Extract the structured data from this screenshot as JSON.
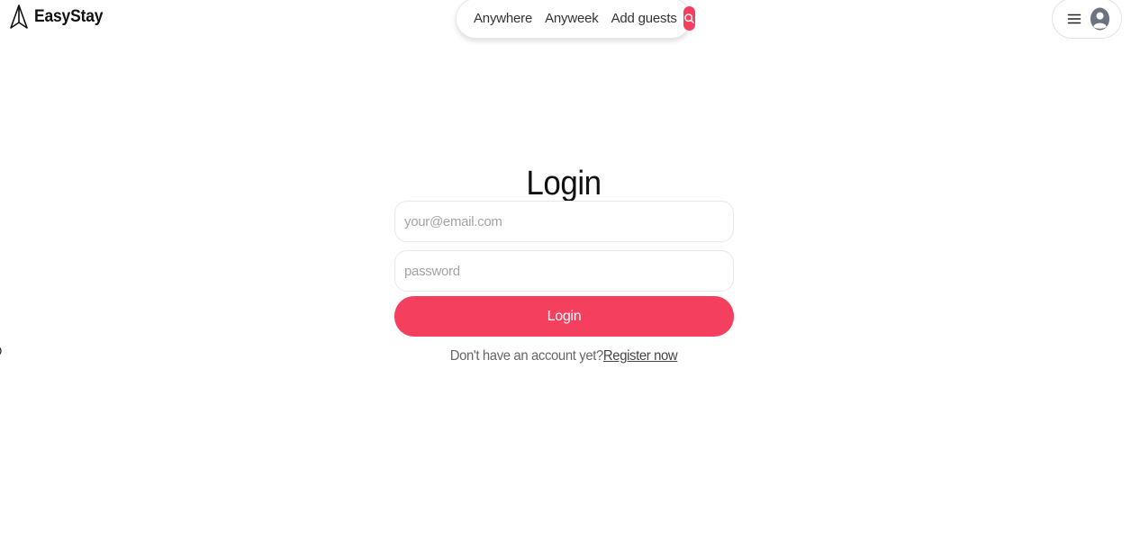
{
  "header": {
    "brand": "EasyStay",
    "search": {
      "location": "Anywhere",
      "week": "Anyweek",
      "guests": "Add guests"
    }
  },
  "login": {
    "title": "Login",
    "email_placeholder": "your@email.com",
    "password_placeholder": "password",
    "button_label": "Login",
    "register_prompt": "Don't have an account yet?",
    "register_link": "Register now"
  },
  "icons": {
    "brand": "paper-plane-icon",
    "search": "search-icon",
    "menu": "hamburger-icon",
    "user": "user-avatar-icon"
  },
  "colors": {
    "accent": "#f43f5e",
    "text": "#222222",
    "muted": "#666666",
    "border": "#e8e8e8"
  }
}
